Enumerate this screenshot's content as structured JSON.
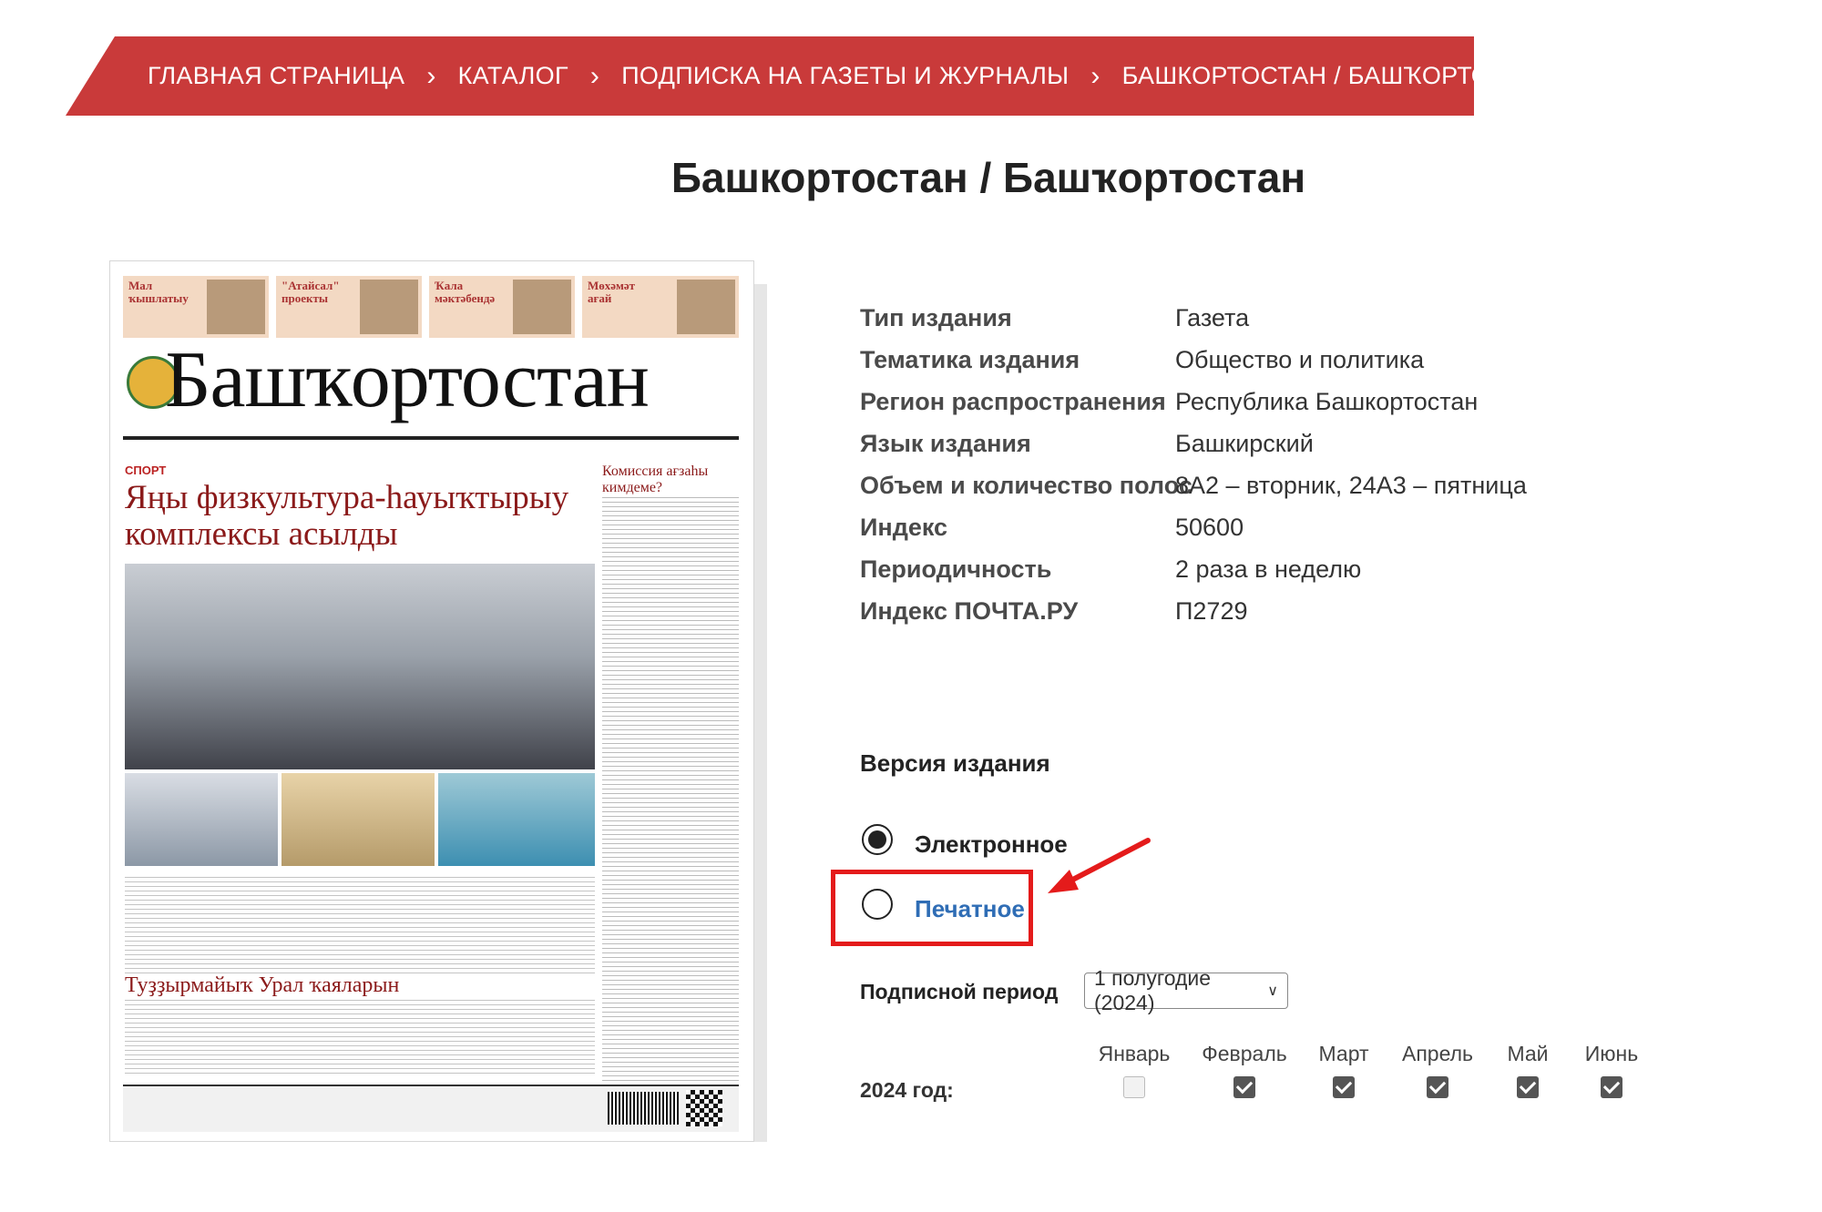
{
  "breadcrumb": {
    "items": [
      "ГЛАВНАЯ СТРАНИЦА",
      "КАТАЛОГ",
      "ПОДПИСКА НА ГАЗЕТЫ И ЖУРНАЛЫ",
      "БАШКОРТОСТАН / БАШҠОРТОСТАН"
    ],
    "separator": "›"
  },
  "page_title": "Башкортостан / Башҡортостан",
  "cover": {
    "masthead": "Башҡортостан",
    "headline": "Яңы физкультура-һауыҡтырыу комплексы асылды",
    "kicker": "СПОРТ",
    "side_headline": "Комиссия ағзаһы кимдеме?",
    "headline2": "Туҙҙырмайыҡ Урал ҡаяларын",
    "teasers": [
      "Мал ҡышлатыу",
      "\"Атайсал\" проекты",
      "Ҡала мәктәбендә",
      "Мөхәмәт ағай"
    ]
  },
  "details": [
    {
      "label": "Тип издания",
      "value": "Газета"
    },
    {
      "label": "Тематика издания",
      "value": "Общество и политика"
    },
    {
      "label": "Регион распространения",
      "value": "Республика Башкортостан"
    },
    {
      "label": "Язык издания",
      "value": "Башкирский"
    },
    {
      "label": "Объем и количество полос",
      "value": "8А2 – вторник, 24А3 – пятница"
    },
    {
      "label": "Индекс",
      "value": "50600"
    },
    {
      "label": "Периодичность",
      "value": "2 раза в неделю"
    },
    {
      "label": "Индекс ПОЧТА.РУ",
      "value": "П2729"
    }
  ],
  "version": {
    "title": "Версия издания",
    "options": [
      {
        "label": "Электронное",
        "selected": true
      },
      {
        "label": "Печатное",
        "selected": false
      }
    ]
  },
  "subscription": {
    "period_label": "Подписной период",
    "period_value": "1 полугодие (2024)",
    "year_label": "2024 год:",
    "months": [
      {
        "name": "Январь",
        "checked": false
      },
      {
        "name": "Февраль",
        "checked": true
      },
      {
        "name": "Март",
        "checked": true
      },
      {
        "name": "Апрель",
        "checked": true
      },
      {
        "name": "Май",
        "checked": true
      },
      {
        "name": "Июнь",
        "checked": true
      }
    ]
  },
  "colors": {
    "breadcrumb_bg": "#c93a3a",
    "link": "#2f6db5",
    "highlight": "#e41b1b"
  }
}
